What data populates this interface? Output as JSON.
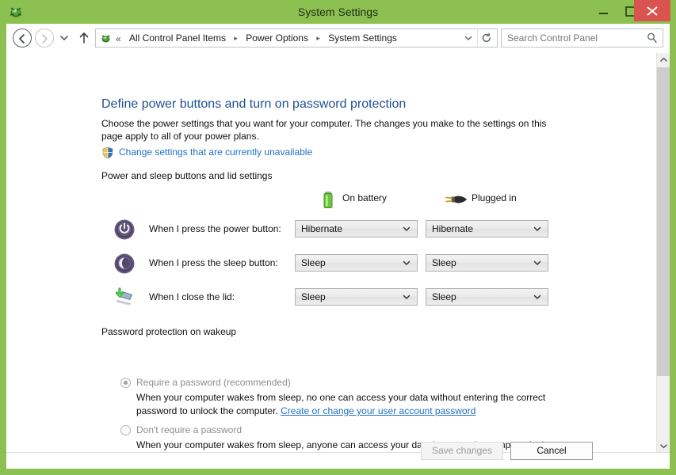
{
  "window": {
    "title": "System Settings",
    "accent_color": "#8cc152",
    "close_button_color": "#d9534f",
    "app_icon": "control-panel-icon",
    "controls": {
      "minimize": "minimize-icon",
      "maximize": "maximize-icon",
      "close": "close-icon"
    }
  },
  "navbar": {
    "back": "back-arrow-icon",
    "forward": "forward-arrow-icon",
    "recent": "recent-pages-chevron-icon",
    "up": "up-arrow-icon",
    "address_icon": "control-panel-icon",
    "overflow_chevrons": "«",
    "breadcrumbs": [
      "All Control Panel Items",
      "Power Options",
      "System Settings"
    ],
    "breadcrumb_separator": "▸",
    "dropdown": "chevron-down-icon",
    "refresh": "refresh-icon",
    "search": {
      "placeholder": "Search Control Panel",
      "value": "",
      "icon": "search-icon"
    }
  },
  "page": {
    "title": "Define power buttons and turn on password protection",
    "description": "Choose the power settings that you want for your computer. The changes you make to the settings on this page apply to all of your power plans.",
    "uac_link": "Change settings that are currently unavailable",
    "uac_icon": "uac-shield-icon"
  },
  "power_section": {
    "header": "Power and sleep buttons and lid settings",
    "columns": [
      {
        "label": "On battery",
        "icon": "battery-icon"
      },
      {
        "label": "Plugged in",
        "icon": "power-plug-icon"
      }
    ],
    "rows": [
      {
        "icon": "power-button-icon",
        "label": "When I press the power button:",
        "on_battery": "Hibernate",
        "plugged_in": "Hibernate"
      },
      {
        "icon": "sleep-button-icon",
        "label": "When I press the sleep button:",
        "on_battery": "Sleep",
        "plugged_in": "Sleep"
      },
      {
        "icon": "laptop-lid-icon",
        "label": "When I close the lid:",
        "on_battery": "Sleep",
        "plugged_in": "Sleep"
      }
    ]
  },
  "password_section": {
    "header": "Password protection on wakeup",
    "options": [
      {
        "label": "Require a password (recommended)",
        "selected": true,
        "description_before_link": "When your computer wakes from sleep, no one can access your data without entering the correct password to unlock the computer. ",
        "link": "Create or change your user account password",
        "description_after_link": ""
      },
      {
        "label": "Don't require a password",
        "selected": false,
        "description_before_link": "When your computer wakes from sleep, anyone can access your data because the computer isn't locked.",
        "link": "",
        "description_after_link": ""
      }
    ]
  },
  "footer": {
    "save_label": "Save changes",
    "save_enabled": false,
    "cancel_label": "Cancel",
    "cancel_enabled": true
  },
  "scrollbar": {
    "up_icon": "chevron-up-icon",
    "down_icon": "chevron-down-icon"
  }
}
